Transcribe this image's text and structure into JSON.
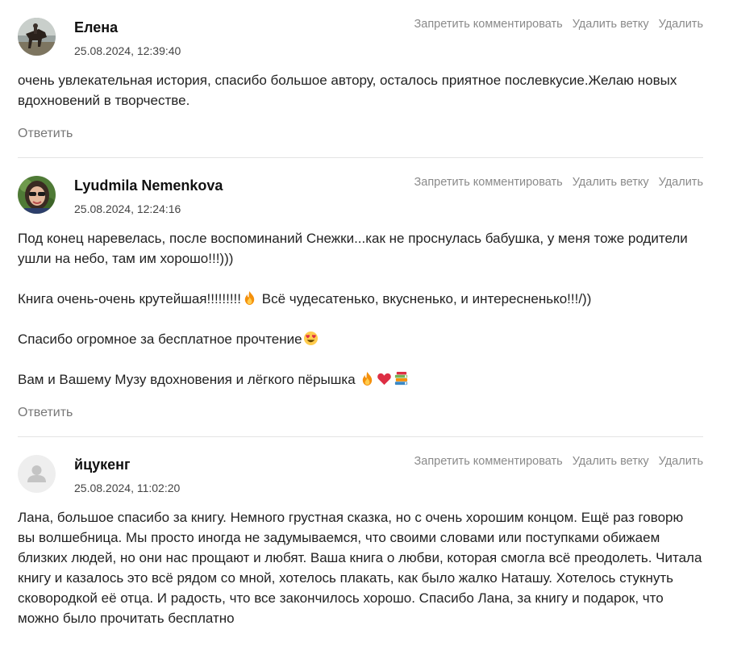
{
  "actions": {
    "ban_label": "Запретить комментировать",
    "delete_thread_label": "Удалить ветку",
    "delete_label": "Удалить"
  },
  "reply_label": "Ответить",
  "comments": [
    {
      "author": "Елена",
      "date": "25.08.2024, 12:39:40",
      "paragraphs": [
        "очень увлекательная история, спасибо большое автору, осталось приятное послевкусие.Желаю новых вдохновений в творчестве."
      ]
    },
    {
      "author": "Lyudmila Nemenkova",
      "date": "25.08.2024, 12:24:16",
      "paragraphs": [
        "Под конец наревелась, после воспоминаний Снежки...как не проснулась бабушка, у меня тоже родители ушли на небо, там им хорошо!!!)))",
        "Книга очень-очень крутейшая!!!!!!!!!",
        " Всё чудесатенько, вкусненько, и интересненько!!!/))",
        "Спасибо огромное за бесплатное прочтение",
        "Вам и Вашему Музу вдохновения и лёгкого пёрышка "
      ]
    },
    {
      "author": "йцукенг",
      "date": "25.08.2024, 11:02:20",
      "paragraphs": [
        "Лана, большое спасибо за книгу. Немного грустная сказка, но с очень хорошим концом. Ещё раз говорю вы волшебница. Мы просто иногда не задумываемся, что своими словами или поступками обижаем близких людей, но они нас прощают и любят. Ваша книга о любви, которая смогла всё преодолеть. Читала книгу и казалось это всё рядом со мной, хотелось плакать, как было жалко Наташу. Хотелось стукнуть сковородкой её отца. И радость, что все закончилось хорошо. Спасибо Лана, за книгу и подарок, что можно было прочитать бесплатно"
      ]
    }
  ]
}
